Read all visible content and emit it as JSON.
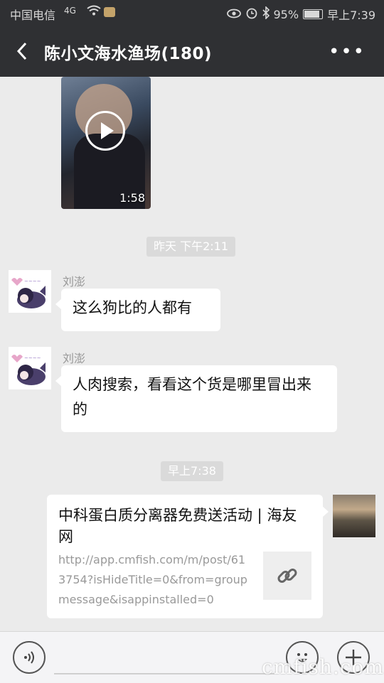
{
  "status_bar": {
    "carrier": "中国电信",
    "network": "4G",
    "battery": "95%",
    "battery_fraction": 0.95,
    "time": "早上7:39"
  },
  "header": {
    "title": "陈小文海水渔场(180)",
    "more_label": "•••"
  },
  "messages": {
    "video": {
      "duration": "1:58"
    },
    "time_1": "昨天 下午2:11",
    "msg_1": {
      "sender": "刘澎",
      "text": "这么狗比的人都有"
    },
    "msg_2": {
      "sender": "刘澎",
      "text": "人肉搜索，看看这个货是哪里冒出来的"
    },
    "time_2": "早上7:38",
    "link": {
      "title": "中科蛋白质分离器免费送活动 | 海友网",
      "url": "http://app.cmfish.com/m/post/613754?isHideTitle=0&from=groupmessage&isappinstalled=0"
    }
  },
  "watermark": "cmfish.com"
}
